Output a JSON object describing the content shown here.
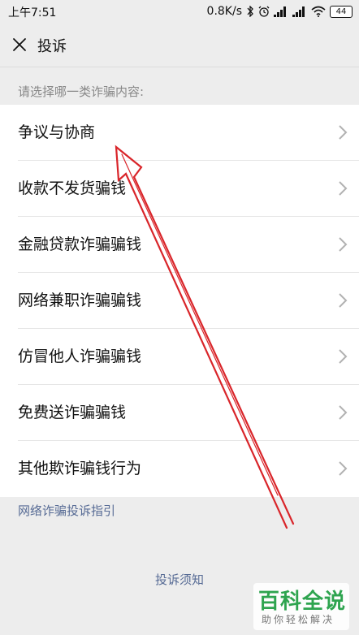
{
  "status_bar": {
    "time": "上午7:51",
    "network_speed": "0.8K/s",
    "battery_level": "44",
    "icons": [
      "bluetooth-icon",
      "alarm-icon",
      "signal-icon",
      "signal-icon",
      "wifi-icon",
      "battery-icon"
    ]
  },
  "nav": {
    "close_icon": "close-icon",
    "title": "投诉"
  },
  "section_hint": "请选择哪一类诈骗内容:",
  "items": [
    {
      "label": "争议与协商"
    },
    {
      "label": "收款不发货骗钱"
    },
    {
      "label": "金融贷款诈骗骗钱"
    },
    {
      "label": "网络兼职诈骗骗钱"
    },
    {
      "label": "仿冒他人诈骗骗钱"
    },
    {
      "label": "免费送诈骗骗钱"
    },
    {
      "label": "其他欺诈骗钱行为"
    }
  ],
  "guide_link": "网络诈骗投诉指引",
  "notice_link": "投诉须知",
  "watermark": {
    "title": "百科全说",
    "subtitle": "助你轻松解决"
  },
  "colors": {
    "background": "#ededed",
    "list_background": "#ffffff",
    "link": "#576b95",
    "hint_text": "#888888",
    "annotation_arrow": "#d9252a",
    "watermark_green": "#2ea44f"
  }
}
